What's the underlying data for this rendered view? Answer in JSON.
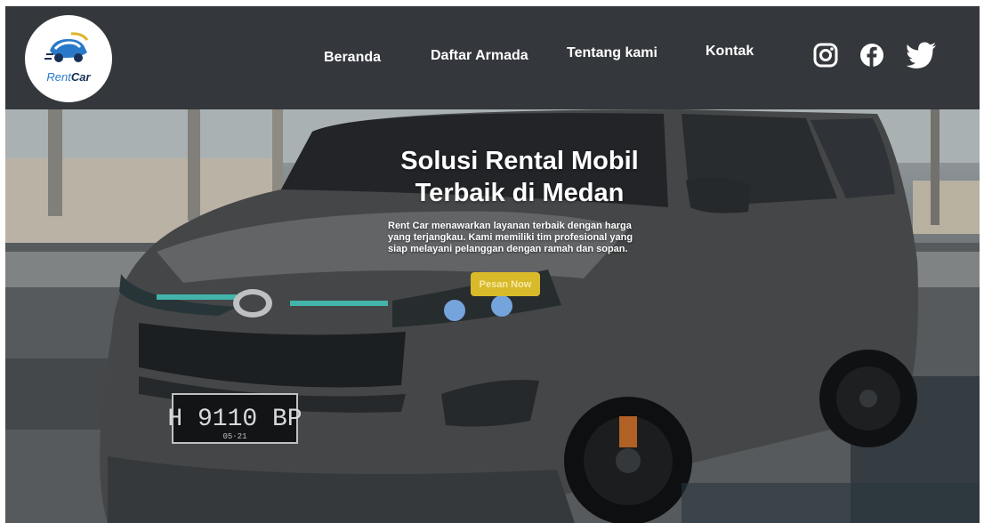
{
  "brand": {
    "logo_text_part1": "Rent",
    "logo_text_part2": "Car"
  },
  "nav": {
    "items": [
      {
        "label": "Beranda"
      },
      {
        "label": "Daftar Armada"
      },
      {
        "label": "Tentang kami"
      },
      {
        "label": "Kontak"
      }
    ]
  },
  "social": {
    "icons": [
      "instagram-icon",
      "facebook-icon",
      "twitter-icon"
    ]
  },
  "hero": {
    "title_line1": "Solusi Rental Mobil",
    "title_line2": "Terbaik di Medan",
    "description": "Rent Car menawarkan layanan terbaik dengan harga yang terjangkau. Kami memiliki tim profesional yang siap melayani pelanggan dengan ramah dan sopan.",
    "cta_label": "Pesan Now",
    "license_plate": "H 9110 BP",
    "license_plate_sub": "05·21"
  },
  "colors": {
    "navbar": "#34373b",
    "cta": "#d8b92a",
    "text": "#ffffff"
  }
}
